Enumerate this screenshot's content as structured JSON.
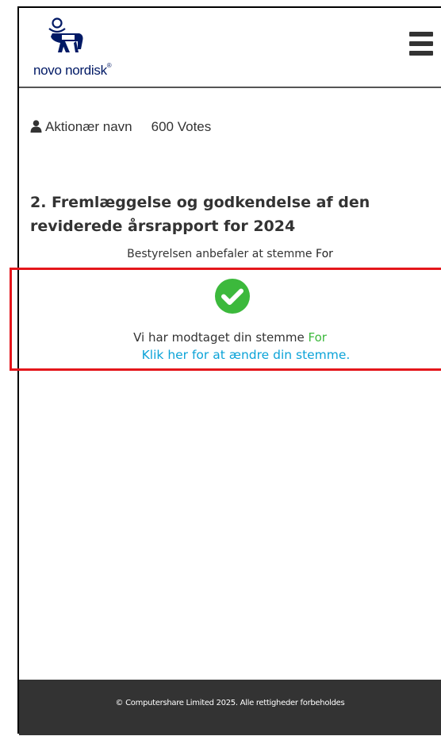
{
  "header": {
    "logo_text": "novo nordisk",
    "logo_mark": "®",
    "menu_icon": "hamburger-menu-icon"
  },
  "shareholder": {
    "icon": "user-icon",
    "name_label": "Aktionær navn",
    "votes": "600 Votes"
  },
  "resolution": {
    "title": "2. Fremlæggelse og godkendelse af den reviderede årsrapport for 2024",
    "recommendation_prefix": "Bestyrelsen anbefaler at stemme",
    "recommendation_value": "For"
  },
  "confirmation": {
    "icon": "check-circle-icon",
    "received_text": "Vi har modtaget din stemme",
    "vote_value": "For",
    "change_link": "Klik her for at ændre din stemme.",
    "colors": {
      "check": "#3cb93c",
      "link": "#0ca3d8",
      "highlight_border": "#e4161b"
    }
  },
  "footer": {
    "copyright": "© Computershare Limited 2025. Alle rettigheder forbeholdes",
    "background": "#333333"
  }
}
